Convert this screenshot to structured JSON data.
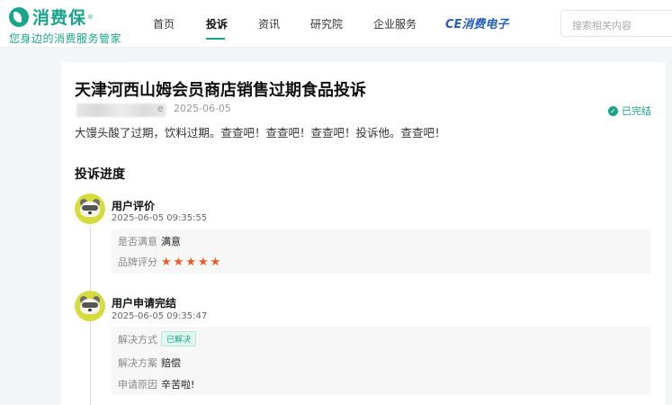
{
  "header": {
    "logo_name": "消费保",
    "logo_reg": "®",
    "slogan": "您身边的消费服务管家",
    "nav": [
      "首页",
      "投诉",
      "资讯",
      "研究院",
      "企业服务"
    ],
    "active_nav": "投诉",
    "ce_brand": "CE消费电子",
    "search_placeholder": "搜索相关内容"
  },
  "complaint": {
    "title": "天津河西山姆会员商店销售过期食品投诉",
    "user_tail": "e",
    "date": "2025-06-05",
    "status": "已完结",
    "description": "大馒头酸了过期，饮料过期。查查吧！查查吧！查查吧！投诉他。查查吧！"
  },
  "progress": {
    "title": "投诉进度",
    "events": [
      {
        "title": "用户评价",
        "time": "2025-06-05 09:35:55",
        "satisfied_label": "是否满意",
        "satisfied_value": "满意",
        "rating_label": "品牌评分",
        "rating": 5
      },
      {
        "title": "用户申请完结",
        "time": "2025-06-05 09:35:47",
        "method_label": "解决方式",
        "method_value": "已解决",
        "plan_label": "解决方案",
        "plan_value": "赔偿",
        "reason_label": "申请原因",
        "reason_value": "辛苦啦!"
      }
    ]
  },
  "colors": {
    "brand": "#1aa58a",
    "star": "#f25a1d",
    "avatar": "#d6dc3c"
  }
}
